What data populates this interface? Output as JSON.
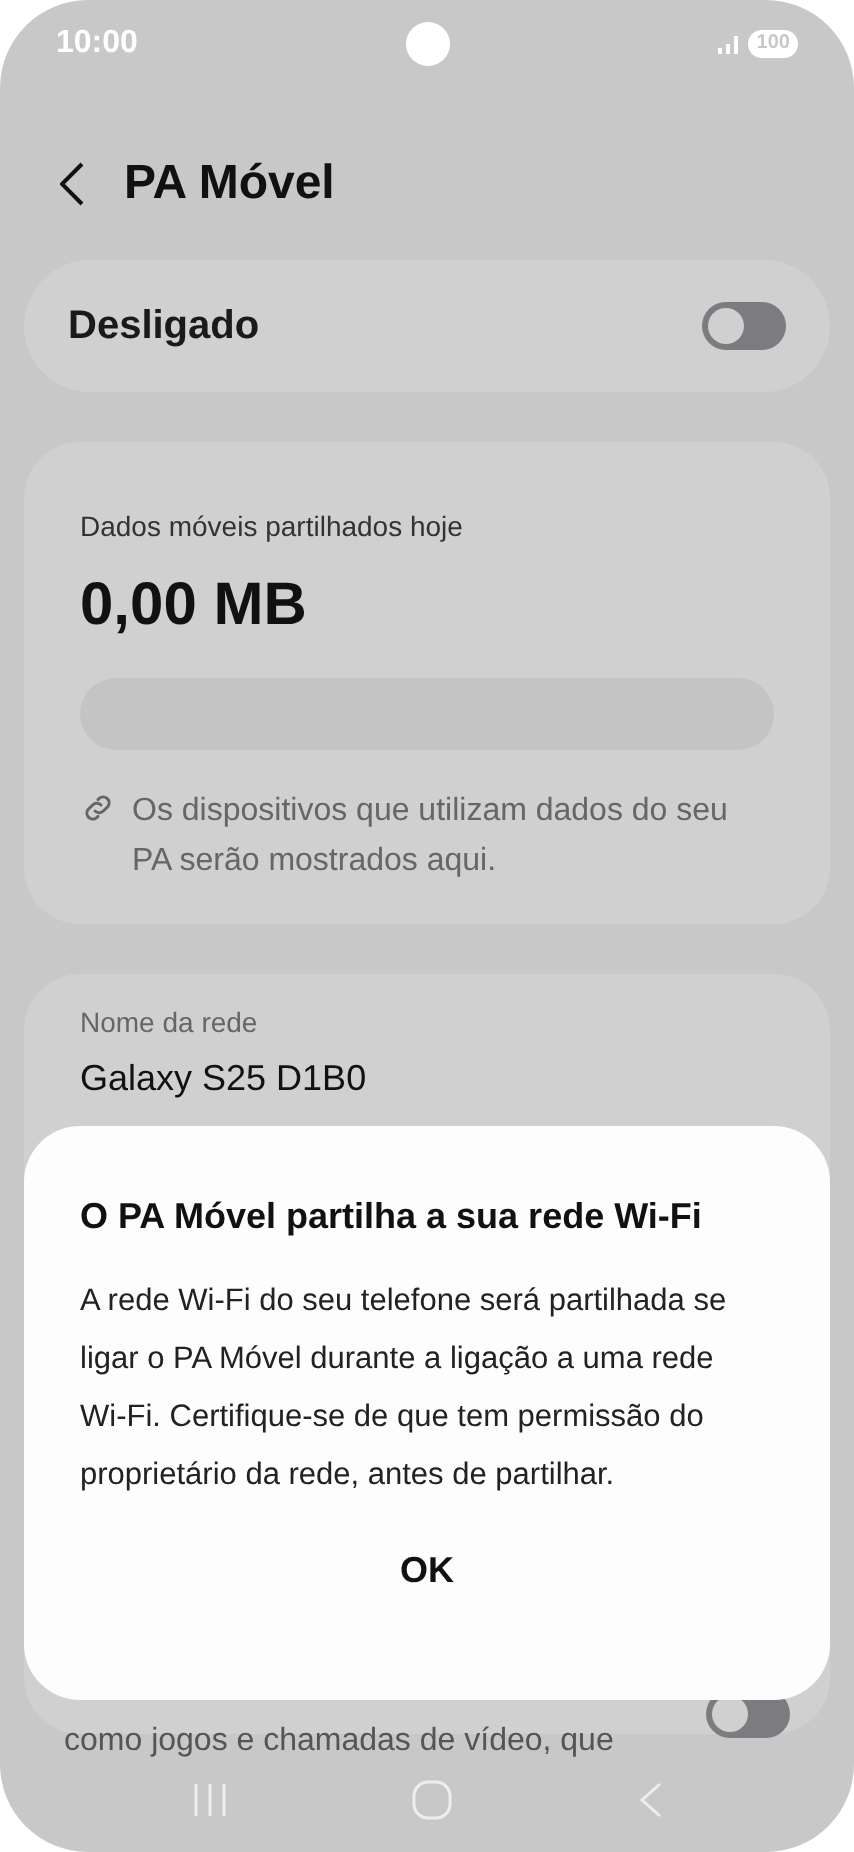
{
  "status_bar": {
    "time": "10:00",
    "battery": "100"
  },
  "header": {
    "title": "PA Móvel"
  },
  "master_switch": {
    "label": "Desligado",
    "on": false
  },
  "usage": {
    "label": "Dados móveis partilhados hoje",
    "amount": "0,00 MB",
    "level": 0,
    "note": "Os dispositivos que utilizam dados do seu PA serão mostrados aqui."
  },
  "network": {
    "name_label": "Nome da rede",
    "name": "Galaxy S25 D1B0",
    "option_text": "como jogos e chamadas de vídeo, que",
    "option_on": false
  },
  "dialog": {
    "title": "O PA Móvel partilha a sua rede Wi-Fi",
    "message": "A rede Wi-Fi do seu telefone será partilhada se ligar o PA Móvel durante a ligação a uma rede Wi-Fi. Certifique-se de que tem permissão do proprietário da rede, antes de partilhar.",
    "button": "OK"
  }
}
